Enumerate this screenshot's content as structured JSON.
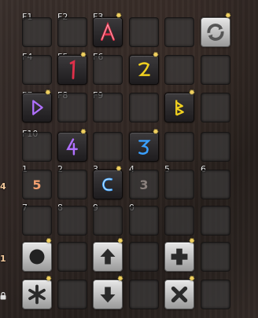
{
  "hotbar_keys": {
    "f1": "F1",
    "f2": "F2",
    "f3": "F3",
    "f4": "F4",
    "f5": "F5",
    "f6": "F6",
    "f7": "F7",
    "f8": "F8",
    "f9": "F9",
    "f10": "F10",
    "n1": "1",
    "n2": "2",
    "n3": "3",
    "n4": "4",
    "n5": "5",
    "n6": "6",
    "n7": "7",
    "n8": "8",
    "n9": "9",
    "n0": "0"
  },
  "slot_texts": {
    "slot_1": "5",
    "slot_4": "3"
  },
  "side_labels": {
    "row5": "4",
    "row7": "1"
  },
  "colors": {
    "rune_red": "#e0304a",
    "rune_yellow": "#f0d020",
    "rune_violet": "#b070ff",
    "rune_blue": "#3aa0ff",
    "number_orange": "#f2a070",
    "gear": "#f0d060"
  },
  "icons": [
    "rune-a-icon",
    "refresh-icon",
    "rune-one-icon",
    "rune-two-icon",
    "rune-triangle-icon",
    "rune-b-icon",
    "rune-four-icon",
    "rune-three-icon",
    "rune-c-icon",
    "circle-icon",
    "arrow-up-icon",
    "plus-icon",
    "asterisk-icon",
    "arrow-down-icon",
    "close-icon",
    "lock-icon"
  ]
}
